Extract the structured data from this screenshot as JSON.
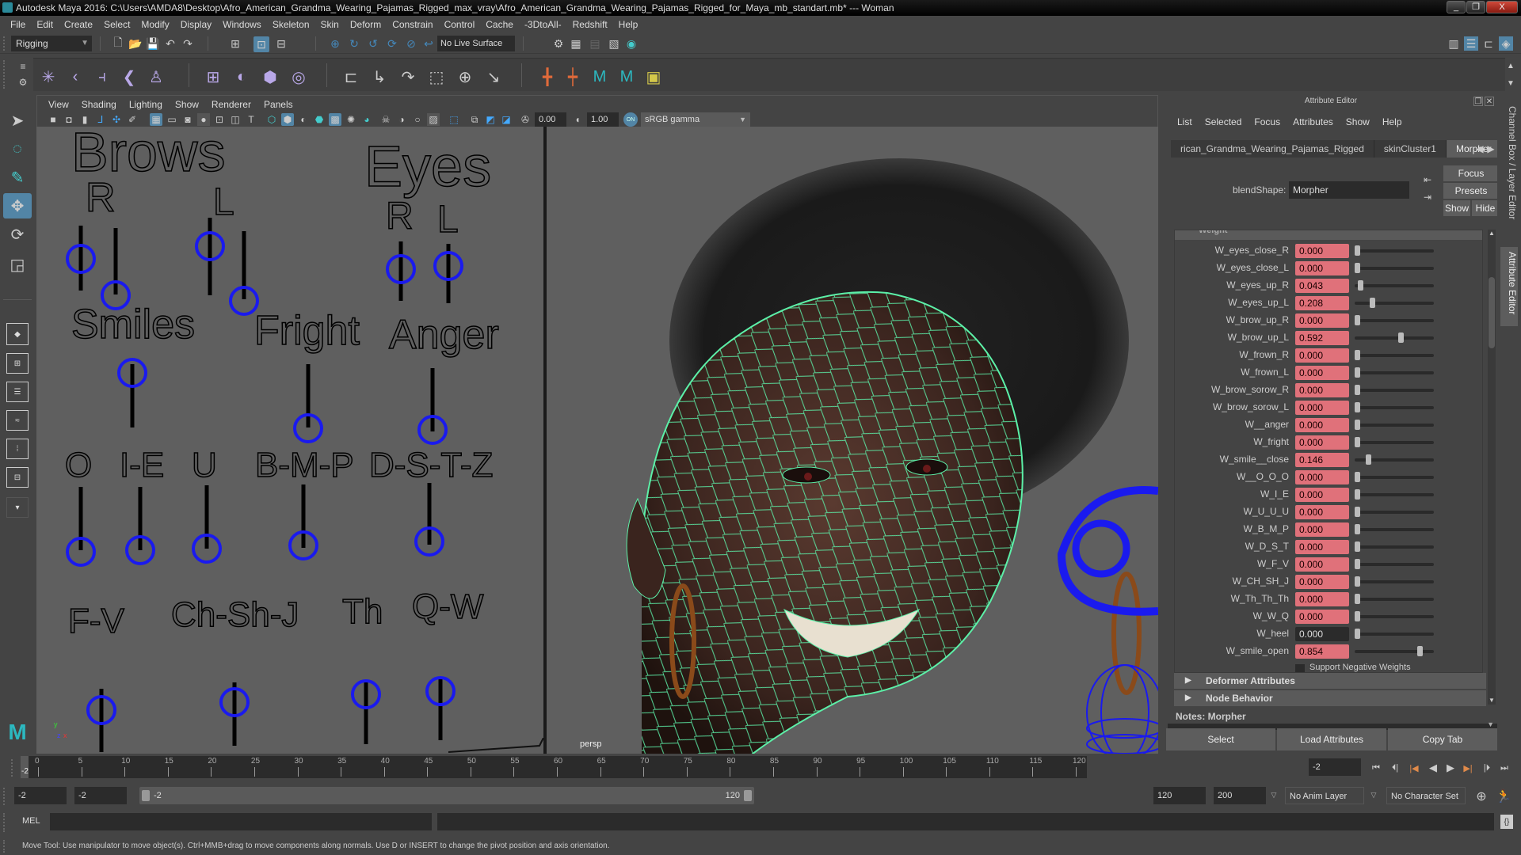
{
  "window": {
    "title": "Autodesk Maya 2016: C:\\Users\\AMDA8\\Desktop\\Afro_American_Grandma_Wearing_Pajamas_Rigged_max_vray\\Afro_American_Grandma_Wearing_Pajamas_Rigged_for_Maya_mb_standart.mb*  ---  Woman",
    "minimize": "_",
    "restore": "❐",
    "close": "X"
  },
  "menubar": [
    "File",
    "Edit",
    "Create",
    "Select",
    "Modify",
    "Display",
    "Windows",
    "Skeleton",
    "Skin",
    "Deform",
    "Constrain",
    "Control",
    "Cache",
    "-3DtoAll-",
    "Redshift",
    "Help"
  ],
  "statusline": {
    "menuset": "Rigging",
    "live_surface": "No Live Surface"
  },
  "shelf": {
    "icons": [
      "joint-tool-icon",
      "ik-handle-icon",
      "ik-spline-icon",
      "insert-joint-icon",
      "humanik-icon",
      "bind-skin-icon",
      "paint-weights-icon",
      "lattice-icon",
      "cluster-icon",
      "parent-constraint-icon",
      "point-constraint-icon",
      "orient-constraint-icon",
      "scale-constraint-icon",
      "aim-constraint-icon",
      "pole-vector-icon",
      "locator-icon",
      "locator-parent-icon",
      "maya-logo-icon",
      "maya-logo-alt-icon",
      "display-layer-icon"
    ]
  },
  "viewport_panel": {
    "menu": [
      "View",
      "Shading",
      "Lighting",
      "Show",
      "Renderer",
      "Panels"
    ],
    "exposure": "0.00",
    "gamma": "1.00",
    "color_mgmt_badge": "ON",
    "color_space": "sRGB gamma",
    "camera_label": "persp"
  },
  "face_board": {
    "labels": [
      {
        "text": "Brows",
        "id": "brows"
      },
      {
        "text": "R",
        "id": "brows-r"
      },
      {
        "text": "L",
        "id": "brows-l"
      },
      {
        "text": "Eyes",
        "id": "eyes"
      },
      {
        "text": "R",
        "id": "eyes-r"
      },
      {
        "text": "L",
        "id": "eyes-l"
      },
      {
        "text": "Smiles",
        "id": "smiles"
      },
      {
        "text": "Fright",
        "id": "fright"
      },
      {
        "text": "Anger",
        "id": "anger"
      },
      {
        "text": "O",
        "id": "o"
      },
      {
        "text": "I-E",
        "id": "ie"
      },
      {
        "text": "U",
        "id": "u"
      },
      {
        "text": "B-M-P",
        "id": "bmp"
      },
      {
        "text": "D-S-T-Z",
        "id": "dstz"
      },
      {
        "text": "F-V",
        "id": "fv"
      },
      {
        "text": "Ch-Sh-J",
        "id": "chshj"
      },
      {
        "text": "Th",
        "id": "th"
      },
      {
        "text": "Q-W",
        "id": "qw"
      }
    ],
    "axis": {
      "y": "y",
      "z": "z",
      "x": "x"
    }
  },
  "attribute_editor": {
    "title": "Attribute Editor",
    "menu": [
      "List",
      "Selected",
      "Focus",
      "Attributes",
      "Show",
      "Help"
    ],
    "tabs": [
      {
        "label": "rican_Grandma_Wearing_Pajamas_Rigged",
        "active": false
      },
      {
        "label": "skinCluster1",
        "active": false
      },
      {
        "label": "Morpher",
        "active": true
      }
    ],
    "blendshape_label": "blendShape:",
    "blendshape_value": "Morpher",
    "buttons": {
      "focus": "Focus",
      "presets": "Presets",
      "show": "Show",
      "hide": "Hide"
    },
    "section_weight": "Weight",
    "weights": [
      {
        "name": "W_eyes_close_R",
        "value": "0.000",
        "keyed": true
      },
      {
        "name": "W_eyes_close_L",
        "value": "0.000",
        "keyed": true
      },
      {
        "name": "W_eyes_up_R",
        "value": "0.043",
        "keyed": true
      },
      {
        "name": "W_eyes_up_L",
        "value": "0.208",
        "keyed": true
      },
      {
        "name": "W_brow_up_R",
        "value": "0.000",
        "keyed": true
      },
      {
        "name": "W_brow_up_L",
        "value": "0.592",
        "keyed": true
      },
      {
        "name": "W_frown_R",
        "value": "0.000",
        "keyed": true
      },
      {
        "name": "W_frown_L",
        "value": "0.000",
        "keyed": true
      },
      {
        "name": "W_brow_sorow_R",
        "value": "0.000",
        "keyed": true
      },
      {
        "name": "W_brow_sorow_L",
        "value": "0.000",
        "keyed": true
      },
      {
        "name": "W__anger",
        "value": "0.000",
        "keyed": true
      },
      {
        "name": "W_fright",
        "value": "0.000",
        "keyed": true
      },
      {
        "name": "W_smile__close",
        "value": "0.146",
        "keyed": true
      },
      {
        "name": "W__O_O_O",
        "value": "0.000",
        "keyed": true
      },
      {
        "name": "W_I_E",
        "value": "0.000",
        "keyed": true
      },
      {
        "name": "W_U_U_U",
        "value": "0.000",
        "keyed": true
      },
      {
        "name": "W_B_M_P",
        "value": "0.000",
        "keyed": true
      },
      {
        "name": "W_D_S_T",
        "value": "0.000",
        "keyed": true
      },
      {
        "name": "W_F_V",
        "value": "0.000",
        "keyed": true
      },
      {
        "name": "W_CH_SH_J",
        "value": "0.000",
        "keyed": true
      },
      {
        "name": "W_Th_Th_Th",
        "value": "0.000",
        "keyed": true
      },
      {
        "name": "W_W_Q",
        "value": "0.000",
        "keyed": true
      },
      {
        "name": "W_heel",
        "value": "0.000",
        "keyed": false
      },
      {
        "name": "W_smile_open",
        "value": "0.854",
        "keyed": true
      }
    ],
    "support_negative_weights": "Support Negative Weights",
    "deformer_attributes": "Deformer Attributes",
    "node_behavior": "Node Behavior",
    "notes": "Notes:  Morpher",
    "bottom_buttons": {
      "select": "Select",
      "load": "Load Attributes",
      "copy": "Copy Tab"
    },
    "side_tabs": {
      "channel_box": "Channel Box / Layer Editor",
      "attribute_editor": "Attribute Editor"
    }
  },
  "timeline": {
    "ticks": [
      0,
      5,
      10,
      15,
      20,
      25,
      30,
      35,
      40,
      45,
      50,
      55,
      60,
      65,
      70,
      75,
      80,
      85,
      90,
      95,
      100,
      105,
      110,
      115,
      120
    ],
    "current_frame_marker": "-2",
    "current_frame": "-2",
    "range_start": "-2",
    "playback_start": "-2",
    "slider_start": "-2",
    "slider_end": "120",
    "playback_end": "120",
    "range_end": "200",
    "anim_layer": "No Anim Layer",
    "character_set": "No Character Set"
  },
  "command_line": {
    "label": "MEL"
  },
  "help_line": "Move Tool: Use manipulator to move object(s). Ctrl+MMB+drag to move components along normals. Use D or INSERT to change the pivot position and axis orientation.",
  "colors": {
    "keyed_field": "#e0717a",
    "active_tool": "#5285a6",
    "wireframe": "#5cf0a8",
    "control_ring": "#1a1aee"
  }
}
